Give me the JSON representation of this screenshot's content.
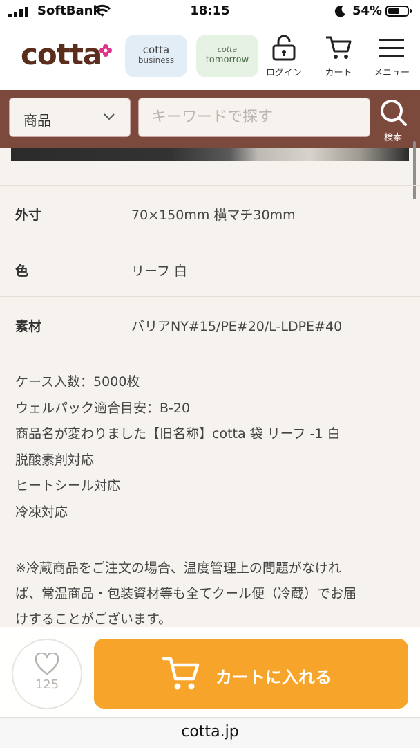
{
  "status_bar": {
    "carrier": "SoftBank",
    "time": "18:15",
    "battery": "54%"
  },
  "header": {
    "logo": "cotta",
    "brands": [
      {
        "line1": "cotta",
        "line2": "business"
      },
      {
        "line1": "cotta",
        "line2": "tomorrow"
      }
    ],
    "login_label": "ログイン",
    "cart_label": "カート",
    "menu_label": "メニュー"
  },
  "search": {
    "category": "商品",
    "placeholder": "キーワードで探す",
    "button_label": "検索"
  },
  "specs": [
    {
      "key": "外寸",
      "value": "70×150mm 横マチ30mm"
    },
    {
      "key": "色",
      "value": "リーフ 白"
    },
    {
      "key": "素材",
      "value": "バリアNY#15/PE#20/L-LDPE#40"
    }
  ],
  "notes": [
    "ケース入数：5000枚",
    "ウェルパック適合目安：B-20",
    "商品名が変わりました【旧名称】cotta 袋 リーフ -1 白",
    "脱酸素剤対応",
    "ヒートシール対応",
    "冷凍対応"
  ],
  "cool_notice": [
    "※冷蔵商品をご注文の場合、温度管理上の問題がなけれ",
    "ば、常温商品・包装資材等も全てクール便（冷蔵）でお届",
    "けすることがございます。"
  ],
  "bottom": {
    "favorite_count": "125",
    "add_to_cart": "カートに入れる"
  },
  "url": "cotta.jp",
  "colors": {
    "brand_brown": "#7b4a3c",
    "accent_orange": "#f7a52a",
    "logo_pink": "#e2338a"
  }
}
